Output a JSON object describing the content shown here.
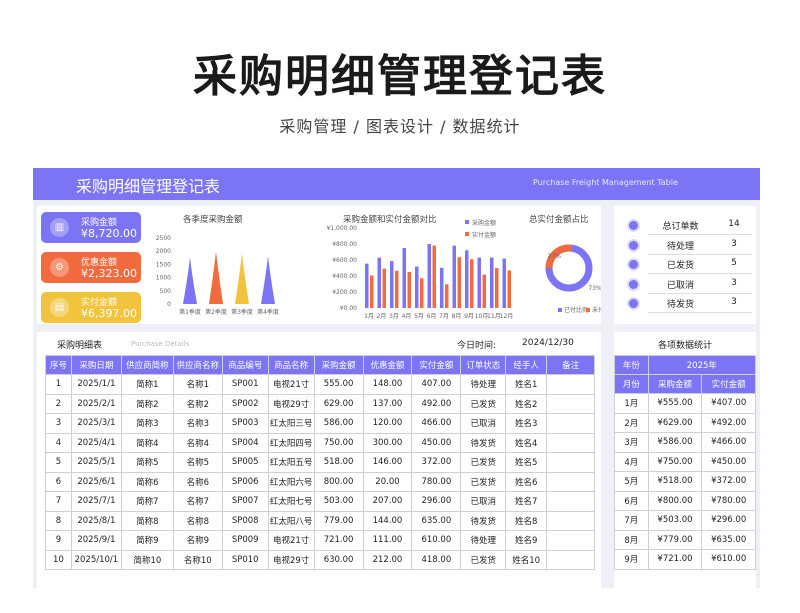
{
  "hero": {
    "title": "采购明细管理登记表",
    "subtitle": "采购管理 / 图表设计 / 数据统计"
  },
  "banner": {
    "title": "采购明细管理登记表",
    "subtitle_en": "Purchase Freight Management Table"
  },
  "colors": {
    "accent": "#7b74f5",
    "orange": "#f26b3f",
    "yellow": "#f2c43d",
    "gray_panel": "#eef0f5"
  },
  "kpi_cards": [
    {
      "label": "采购金额",
      "value": "¥8,720.00",
      "icon": "bar-chart-icon",
      "glyph": "▥",
      "color": "#7b74f5"
    },
    {
      "label": "优惠金额",
      "value": "¥2,323.00",
      "icon": "gear-icon",
      "glyph": "⚙",
      "color": "#f26b3f"
    },
    {
      "label": "实付金额",
      "value": "¥6,397.00",
      "icon": "document-icon",
      "glyph": "▤",
      "color": "#f2c43d"
    }
  ],
  "chart_data": [
    {
      "type": "area",
      "title": "各季度采购金额",
      "categories": [
        "第1季度",
        "第2季度",
        "第3季度",
        "第4季度"
      ],
      "values": [
        1770,
        2000,
        1920,
        1830
      ],
      "yticks": [
        "2500",
        "2000",
        "1500",
        "1000",
        "500",
        "0"
      ],
      "ylim": [
        0,
        2500
      ],
      "colors": [
        "#7b74f5",
        "#f26b3f",
        "#f2c43d",
        "#7b74f5"
      ]
    },
    {
      "type": "bar",
      "title": "采购金额和实付金额对比",
      "categories": [
        "1月",
        "2月",
        "3月",
        "4月",
        "5月",
        "6月",
        "7月",
        "8月",
        "9月",
        "10月",
        "11月",
        "12月"
      ],
      "series": [
        {
          "name": "采购金额",
          "color": "#7b74f5",
          "values": [
            555,
            629,
            586,
            750,
            518,
            800,
            503,
            779,
            721,
            630,
            630,
            618
          ]
        },
        {
          "name": "实付金额",
          "color": "#f26b3f",
          "values": [
            407,
            492,
            466,
            450,
            372,
            780,
            296,
            635,
            610,
            418,
            500,
            470
          ]
        }
      ],
      "yticks": [
        "¥1,000.00",
        "¥800.00",
        "¥600.00",
        "¥400.00",
        "¥200.00",
        "¥0.00"
      ],
      "ylim": [
        0,
        1000
      ],
      "legend": "top-right"
    },
    {
      "type": "pie",
      "title": "总实付金额占比",
      "slices": [
        {
          "name": "已付比例",
          "value": 73,
          "label": "73%",
          "color": "#7b74f5"
        },
        {
          "name": "未付比例",
          "value": 27,
          "label": "27%",
          "color": "#f26b3f"
        }
      ],
      "legend": "bottom"
    }
  ],
  "side_stats": [
    {
      "label": "总订单数",
      "value": "14"
    },
    {
      "label": "待处理",
      "value": "3"
    },
    {
      "label": "已发货",
      "value": "5"
    },
    {
      "label": "已取消",
      "value": "3"
    },
    {
      "label": "待发货",
      "value": "3"
    }
  ],
  "table": {
    "title": "采购明细表",
    "title_en": "Purchase Details",
    "date_label": "今日时间:",
    "date": "2024/12/30",
    "headers": [
      "序号",
      "采购日期",
      "供应商简称",
      "供应商名称",
      "商品编号",
      "商品名称",
      "采购金额",
      "优惠金额",
      "实付金额",
      "订单状态",
      "经手人",
      "备注"
    ],
    "rows": [
      [
        "1",
        "2025/1/1",
        "简称1",
        "名称1",
        "SP001",
        "电视21寸",
        "555.00",
        "148.00",
        "407.00",
        "待处理",
        "姓名1",
        ""
      ],
      [
        "2",
        "2025/2/1",
        "简称2",
        "名称2",
        "SP002",
        "电视29寸",
        "629.00",
        "137.00",
        "492.00",
        "已发货",
        "姓名2",
        ""
      ],
      [
        "3",
        "2025/3/1",
        "简称3",
        "名称3",
        "SP003",
        "红太阳三号",
        "586.00",
        "120.00",
        "466.00",
        "已取消",
        "姓名3",
        ""
      ],
      [
        "4",
        "2025/4/1",
        "简称4",
        "名称4",
        "SP004",
        "红太阳四号",
        "750.00",
        "300.00",
        "450.00",
        "待发货",
        "姓名4",
        ""
      ],
      [
        "5",
        "2025/5/1",
        "简称5",
        "名称5",
        "SP005",
        "红太阳五号",
        "518.00",
        "146.00",
        "372.00",
        "已发货",
        "姓名5",
        ""
      ],
      [
        "6",
        "2025/6/1",
        "简称6",
        "名称6",
        "SP006",
        "红太阳六号",
        "800.00",
        "20.00",
        "780.00",
        "已发货",
        "姓名6",
        ""
      ],
      [
        "7",
        "2025/7/1",
        "简称7",
        "名称7",
        "SP007",
        "红太阳七号",
        "503.00",
        "207.00",
        "296.00",
        "已取消",
        "姓名7",
        ""
      ],
      [
        "8",
        "2025/8/1",
        "简称8",
        "名称8",
        "SP008",
        "红太阳八号",
        "779.00",
        "144.00",
        "635.00",
        "待发货",
        "姓名8",
        ""
      ],
      [
        "9",
        "2025/9/1",
        "简称9",
        "名称9",
        "SP009",
        "电视21寸",
        "721.00",
        "111.00",
        "610.00",
        "待处理",
        "姓名9",
        ""
      ],
      [
        "10",
        "2025/10/1",
        "简称10",
        "名称10",
        "SP010",
        "电视29寸",
        "630.00",
        "212.00",
        "418.00",
        "已发货",
        "姓名10",
        ""
      ]
    ]
  },
  "monthly": {
    "title": "各项数据统计",
    "year_label": "年份",
    "year": "2025年",
    "headers": [
      "月份",
      "采购金额",
      "实付金额"
    ],
    "rows": [
      [
        "1月",
        "¥555.00",
        "¥407.00"
      ],
      [
        "2月",
        "¥629.00",
        "¥492.00"
      ],
      [
        "3月",
        "¥586.00",
        "¥466.00"
      ],
      [
        "4月",
        "¥750.00",
        "¥450.00"
      ],
      [
        "5月",
        "¥518.00",
        "¥372.00"
      ],
      [
        "6月",
        "¥800.00",
        "¥780.00"
      ],
      [
        "7月",
        "¥503.00",
        "¥296.00"
      ],
      [
        "8月",
        "¥779.00",
        "¥635.00"
      ],
      [
        "9月",
        "¥721.00",
        "¥610.00"
      ]
    ]
  }
}
